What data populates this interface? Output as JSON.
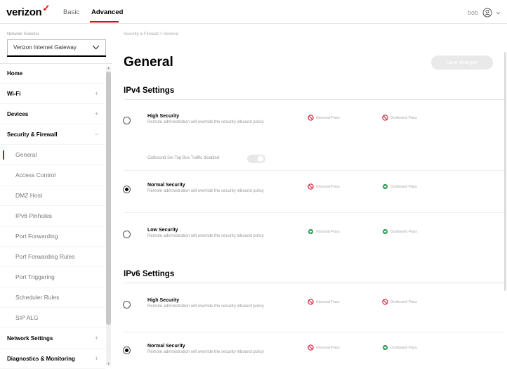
{
  "header": {
    "logo": "verizon",
    "logo_mark": "✓",
    "tabs": [
      {
        "label": "Basic",
        "active": false
      },
      {
        "label": "Advanced",
        "active": true
      }
    ],
    "user_text": "bob",
    "accent_color": "#ee0000"
  },
  "sidebar": {
    "network_label": "Network Selector",
    "network_value": "Verizon Internet Gateway",
    "items": [
      {
        "label": "Home",
        "type": "section",
        "expander": ""
      },
      {
        "label": "Wi-Fi",
        "type": "section",
        "expander": "+"
      },
      {
        "label": "Devices",
        "type": "section",
        "expander": "+"
      },
      {
        "label": "Security & Firewall",
        "type": "section",
        "expander": "−"
      },
      {
        "label": "General",
        "type": "sub",
        "active": true
      },
      {
        "label": "Access Control",
        "type": "sub"
      },
      {
        "label": "DMZ Host",
        "type": "sub"
      },
      {
        "label": "IPv6 Pinholes",
        "type": "sub"
      },
      {
        "label": "Port Forwarding",
        "type": "sub"
      },
      {
        "label": "Port Forwarding Rules",
        "type": "sub"
      },
      {
        "label": "Port Triggering",
        "type": "sub"
      },
      {
        "label": "Scheduler Rules",
        "type": "sub"
      },
      {
        "label": "SIP ALG",
        "type": "sub"
      },
      {
        "label": "Network Settings",
        "type": "section",
        "expander": "+"
      },
      {
        "label": "Diagnostics & Monitoring",
        "type": "section",
        "expander": "+"
      }
    ]
  },
  "main": {
    "breadcrumb": "Security & Firewall > General",
    "title": "General",
    "save_label": "Save changes",
    "ipv4": {
      "header": "IPv4 Settings",
      "toggle_label": "Outbound Set Top Box Traffic disabled",
      "options": [
        {
          "name": "High Security",
          "desc": "Remote administration will override the security inbound policy",
          "selected": false,
          "inbound": "Inbound Pass",
          "inbound_icon": "block-icon",
          "outbound": "Outbound Pass",
          "outbound_icon": "block-icon"
        },
        {
          "name": "Normal Security",
          "desc": "Remote administration will override the security inbound policy",
          "selected": true,
          "inbound": "Inbound Pass",
          "inbound_icon": "block-icon",
          "outbound": "Outbound Pass",
          "outbound_icon": "allow-icon"
        },
        {
          "name": "Low Security",
          "desc": "Remote administration will override the security inbound policy",
          "selected": false,
          "inbound": "Inbound Pass",
          "inbound_icon": "allow-icon",
          "outbound": "Outbound Pass",
          "outbound_icon": "allow-icon"
        }
      ]
    },
    "ipv6": {
      "header": "IPv6 Settings",
      "options": [
        {
          "name": "High Security",
          "desc": "Remote administration will override the security inbound policy",
          "selected": false,
          "inbound": "Inbound Pass",
          "inbound_icon": "block-icon",
          "outbound": "Outbound Pass",
          "outbound_icon": "block-icon"
        },
        {
          "name": "Normal Security",
          "desc": "Remote administration will override the security inbound policy",
          "selected": true,
          "inbound": "Inbound Pass",
          "inbound_icon": "block-icon",
          "outbound": "Outbound Pass",
          "outbound_icon": "allow-icon"
        }
      ]
    },
    "colors": {
      "block": "#e0304a",
      "allow": "#2e9e52"
    }
  }
}
